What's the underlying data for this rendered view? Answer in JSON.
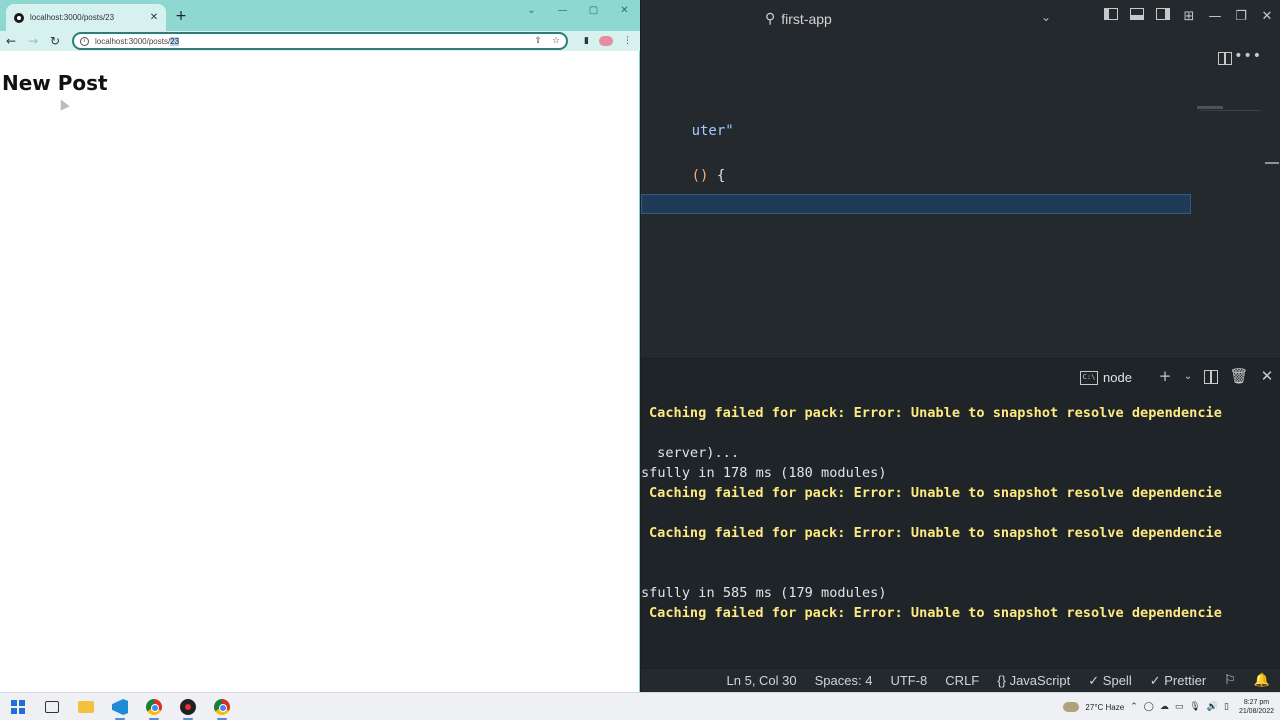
{
  "browser": {
    "tab": {
      "title": "localhost:3000/posts/23",
      "close": "✕"
    },
    "new_tab": "+",
    "window": {
      "minimize": "—",
      "restore": "▢",
      "close": "✕",
      "chevron": "⌄"
    },
    "nav": {
      "back": "←",
      "forward": "→",
      "reload": "↻"
    },
    "address": {
      "url_prefix": "localhost:3000/posts/",
      "url_selected": "23"
    },
    "page": {
      "heading": "New Post"
    }
  },
  "vscode": {
    "title": "first-app",
    "editor": {
      "line1": {
        "string": "uter\""
      },
      "line2": {
        "paren": "()",
        "brace": " {"
      }
    },
    "terminal": {
      "tab_label": "node",
      "lines": [
        {
          "text": "Caching failed for pack: Error: Unable to snapshot resolve dependencie",
          "warn": true
        },
        {
          "text": " server)...",
          "warn": false
        },
        {
          "text": "sfully in 178 ms (180 modules)",
          "warn": false
        },
        {
          "text": "Caching failed for pack: Error: Unable to snapshot resolve dependencie",
          "warn": true
        },
        {
          "text": "Caching failed for pack: Error: Unable to snapshot resolve dependencie",
          "warn": true
        },
        {
          "text": "sfully in 585 ms (179 modules)",
          "warn": false
        },
        {
          "text": "Caching failed for pack: Error: Unable to snapshot resolve dependencie",
          "warn": true
        }
      ]
    },
    "status": {
      "position": "Ln 5, Col 30",
      "spaces": "Spaces: 4",
      "encoding": "UTF-8",
      "eol": "CRLF",
      "language": "JavaScript",
      "spell": "Spell",
      "prettier": "Prettier"
    }
  },
  "taskbar": {
    "weather": "27°C  Haze",
    "time": "8:27 pm",
    "date": "21/08/2022"
  },
  "colors": {
    "browser_frame": "#8fd8d2",
    "editor_bg": "#24292e",
    "terminal_warning": "#ffea7f",
    "selection": "#1f3b57"
  }
}
